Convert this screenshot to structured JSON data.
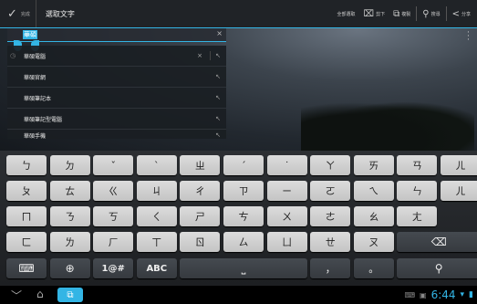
{
  "action_bar": {
    "done_label": "完成",
    "title": "選取文字",
    "actions": [
      {
        "label": "全部選取",
        "icon": "select-all-icon",
        "glyph": ""
      },
      {
        "label": "剪下",
        "icon": "cut-icon",
        "glyph": "⌧"
      },
      {
        "label": "複製",
        "icon": "copy-icon",
        "glyph": "⧉"
      },
      {
        "label": "搜尋",
        "icon": "search-icon",
        "glyph": "⚲"
      },
      {
        "label": "分享",
        "icon": "share-icon",
        "glyph": "<"
      }
    ]
  },
  "search": {
    "selected_text": "華碩",
    "clear_glyph": "×"
  },
  "suggestions": [
    {
      "text": "華碩電腦",
      "history": true
    },
    {
      "text": "華碩官網",
      "history": false
    },
    {
      "text": "華碩筆記本",
      "history": false
    },
    {
      "text": "華碩筆記型電腦",
      "history": false
    },
    {
      "text": "華碩手機",
      "history": false
    }
  ],
  "keyboard": {
    "row1": [
      "ㄅ",
      "ㄉ",
      "ˇ",
      "ˋ",
      "ㄓ",
      "ˊ",
      "˙",
      "ㄚ",
      "ㄞ",
      "ㄢ",
      "ㄦ"
    ],
    "row2": [
      "ㄆ",
      "ㄊ",
      "ㄍ",
      "ㄐ",
      "ㄔ",
      "ㄗ",
      "ㄧ",
      "ㄛ",
      "ㄟ",
      "ㄣ",
      "ㄦ"
    ],
    "row3": [
      "ㄇ",
      "ㄋ",
      "ㄎ",
      "ㄑ",
      "ㄕ",
      "ㄘ",
      "ㄨ",
      "ㄜ",
      "ㄠ",
      "ㄤ"
    ],
    "row4": [
      "ㄈ",
      "ㄌ",
      "ㄏ",
      "ㄒ",
      "ㄖ",
      "ㄙ",
      "ㄩ",
      "ㄝ",
      "ㄡ"
    ],
    "row5": [
      "⌨",
      "⊕",
      "1@#",
      "ABC",
      "⎵",
      "，",
      "。",
      "⚲"
    ],
    "backspace": "⌫"
  },
  "nav": {
    "back": "﹀",
    "home": "⌂",
    "recent": "⧉",
    "time": "6:44"
  },
  "colors": {
    "accent": "#33b5e5"
  }
}
